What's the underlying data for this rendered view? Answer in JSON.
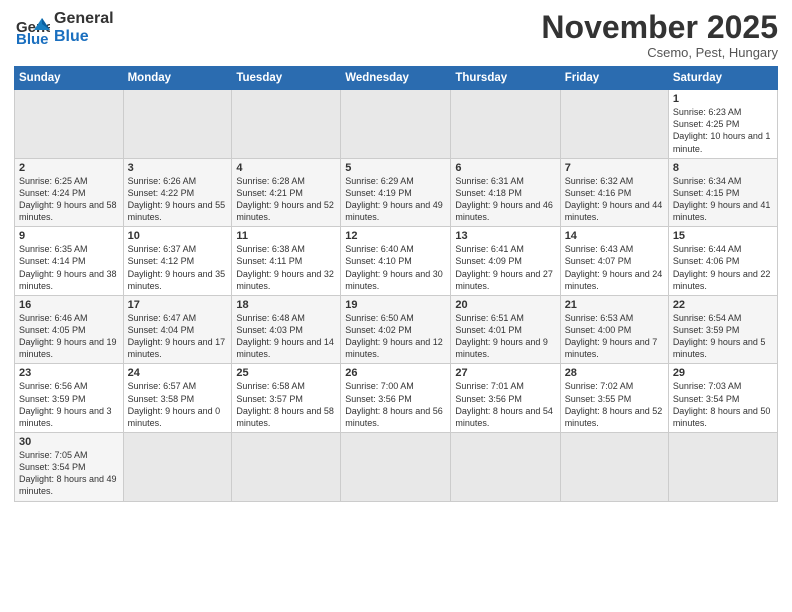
{
  "logo": {
    "text_general": "General",
    "text_blue": "Blue"
  },
  "header": {
    "title": "November 2025",
    "subtitle": "Csemo, Pest, Hungary"
  },
  "weekdays": [
    "Sunday",
    "Monday",
    "Tuesday",
    "Wednesday",
    "Thursday",
    "Friday",
    "Saturday"
  ],
  "weeks": [
    [
      {
        "day": "",
        "info": ""
      },
      {
        "day": "",
        "info": ""
      },
      {
        "day": "",
        "info": ""
      },
      {
        "day": "",
        "info": ""
      },
      {
        "day": "",
        "info": ""
      },
      {
        "day": "",
        "info": ""
      },
      {
        "day": "1",
        "info": "Sunrise: 6:23 AM\nSunset: 4:25 PM\nDaylight: 10 hours and 1 minute."
      }
    ],
    [
      {
        "day": "2",
        "info": "Sunrise: 6:25 AM\nSunset: 4:24 PM\nDaylight: 9 hours and 58 minutes."
      },
      {
        "day": "3",
        "info": "Sunrise: 6:26 AM\nSunset: 4:22 PM\nDaylight: 9 hours and 55 minutes."
      },
      {
        "day": "4",
        "info": "Sunrise: 6:28 AM\nSunset: 4:21 PM\nDaylight: 9 hours and 52 minutes."
      },
      {
        "day": "5",
        "info": "Sunrise: 6:29 AM\nSunset: 4:19 PM\nDaylight: 9 hours and 49 minutes."
      },
      {
        "day": "6",
        "info": "Sunrise: 6:31 AM\nSunset: 4:18 PM\nDaylight: 9 hours and 46 minutes."
      },
      {
        "day": "7",
        "info": "Sunrise: 6:32 AM\nSunset: 4:16 PM\nDaylight: 9 hours and 44 minutes."
      },
      {
        "day": "8",
        "info": "Sunrise: 6:34 AM\nSunset: 4:15 PM\nDaylight: 9 hours and 41 minutes."
      }
    ],
    [
      {
        "day": "9",
        "info": "Sunrise: 6:35 AM\nSunset: 4:14 PM\nDaylight: 9 hours and 38 minutes."
      },
      {
        "day": "10",
        "info": "Sunrise: 6:37 AM\nSunset: 4:12 PM\nDaylight: 9 hours and 35 minutes."
      },
      {
        "day": "11",
        "info": "Sunrise: 6:38 AM\nSunset: 4:11 PM\nDaylight: 9 hours and 32 minutes."
      },
      {
        "day": "12",
        "info": "Sunrise: 6:40 AM\nSunset: 4:10 PM\nDaylight: 9 hours and 30 minutes."
      },
      {
        "day": "13",
        "info": "Sunrise: 6:41 AM\nSunset: 4:09 PM\nDaylight: 9 hours and 27 minutes."
      },
      {
        "day": "14",
        "info": "Sunrise: 6:43 AM\nSunset: 4:07 PM\nDaylight: 9 hours and 24 minutes."
      },
      {
        "day": "15",
        "info": "Sunrise: 6:44 AM\nSunset: 4:06 PM\nDaylight: 9 hours and 22 minutes."
      }
    ],
    [
      {
        "day": "16",
        "info": "Sunrise: 6:46 AM\nSunset: 4:05 PM\nDaylight: 9 hours and 19 minutes."
      },
      {
        "day": "17",
        "info": "Sunrise: 6:47 AM\nSunset: 4:04 PM\nDaylight: 9 hours and 17 minutes."
      },
      {
        "day": "18",
        "info": "Sunrise: 6:48 AM\nSunset: 4:03 PM\nDaylight: 9 hours and 14 minutes."
      },
      {
        "day": "19",
        "info": "Sunrise: 6:50 AM\nSunset: 4:02 PM\nDaylight: 9 hours and 12 minutes."
      },
      {
        "day": "20",
        "info": "Sunrise: 6:51 AM\nSunset: 4:01 PM\nDaylight: 9 hours and 9 minutes."
      },
      {
        "day": "21",
        "info": "Sunrise: 6:53 AM\nSunset: 4:00 PM\nDaylight: 9 hours and 7 minutes."
      },
      {
        "day": "22",
        "info": "Sunrise: 6:54 AM\nSunset: 3:59 PM\nDaylight: 9 hours and 5 minutes."
      }
    ],
    [
      {
        "day": "23",
        "info": "Sunrise: 6:56 AM\nSunset: 3:59 PM\nDaylight: 9 hours and 3 minutes."
      },
      {
        "day": "24",
        "info": "Sunrise: 6:57 AM\nSunset: 3:58 PM\nDaylight: 9 hours and 0 minutes."
      },
      {
        "day": "25",
        "info": "Sunrise: 6:58 AM\nSunset: 3:57 PM\nDaylight: 8 hours and 58 minutes."
      },
      {
        "day": "26",
        "info": "Sunrise: 7:00 AM\nSunset: 3:56 PM\nDaylight: 8 hours and 56 minutes."
      },
      {
        "day": "27",
        "info": "Sunrise: 7:01 AM\nSunset: 3:56 PM\nDaylight: 8 hours and 54 minutes."
      },
      {
        "day": "28",
        "info": "Sunrise: 7:02 AM\nSunset: 3:55 PM\nDaylight: 8 hours and 52 minutes."
      },
      {
        "day": "29",
        "info": "Sunrise: 7:03 AM\nSunset: 3:54 PM\nDaylight: 8 hours and 50 minutes."
      }
    ],
    [
      {
        "day": "30",
        "info": "Sunrise: 7:05 AM\nSunset: 3:54 PM\nDaylight: 8 hours and 49 minutes."
      },
      {
        "day": "",
        "info": ""
      },
      {
        "day": "",
        "info": ""
      },
      {
        "day": "",
        "info": ""
      },
      {
        "day": "",
        "info": ""
      },
      {
        "day": "",
        "info": ""
      },
      {
        "day": "",
        "info": ""
      }
    ]
  ]
}
